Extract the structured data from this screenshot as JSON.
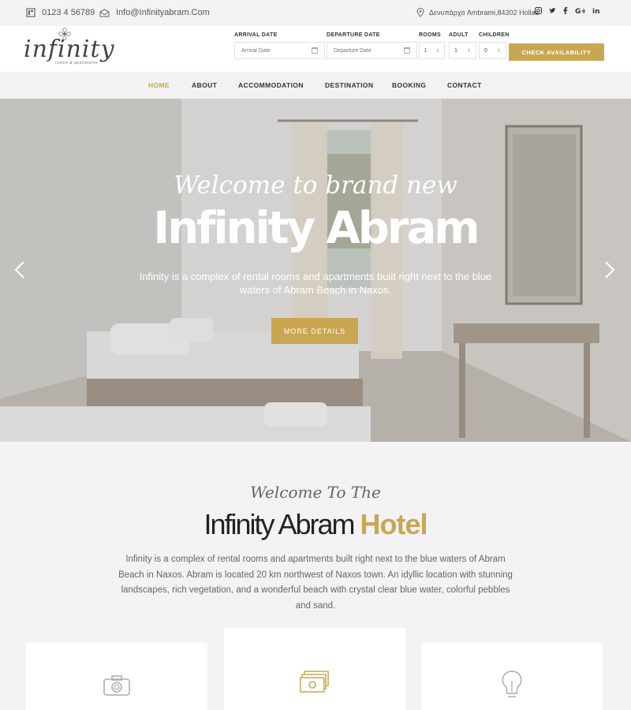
{
  "topbar": {
    "phone": "0123 4 56789",
    "email": "Info@Infinityabram.Com",
    "address": "Δενυπάρχα Ambrami,84302 Hollas",
    "social": [
      "instagram-icon",
      "twitter-icon",
      "facebook-icon",
      "google-plus-icon",
      "linkedin-icon"
    ]
  },
  "logo": {
    "text": "infinity",
    "tagline": "rooms & apartments"
  },
  "booking": {
    "arrival_label": "ARRIVAL DATE",
    "arrival_placeholder": "Arrival Date",
    "departure_label": "DEPARTURE DATE",
    "departure_placeholder": "Departure Date",
    "rooms_label": "ROOMS",
    "rooms_value": "1",
    "adult_label": "ADULT",
    "adult_value": "1",
    "children_label": "CHILDREN",
    "children_value": "0",
    "button": "CHECK AVAILABILITY"
  },
  "nav": {
    "home": "HOME",
    "about": "ABOUT",
    "accommodation": "ACCOMMODATION",
    "destination": "DESTINATION",
    "booking": "BOOKING",
    "contact": "CONTACT"
  },
  "hero": {
    "script": "Welcome to brand new",
    "title": "Infinity Abram",
    "description": "Infinity is a complex of rental rooms and apartments built right next to the blue waters of Abram Beach in Naxos.",
    "button": "MORE DETAILS"
  },
  "welcome": {
    "script": "Welcome To The",
    "title_main": "Infinity Abram",
    "title_accent": "Hotel",
    "text": "Infinity is a complex of rental rooms and apartments built right next to the blue waters of Abram Beach in Naxos. Abram is located 20 km northwest of Naxos town. An idyllic location with stunning landscapes, rich vegetation, and a wonderful beach with crystal clear blue water, colorful pebbles and sand."
  },
  "colors": {
    "accent": "#c9a752",
    "nav_bg": "#f2f2f2",
    "topbar_bg": "#f3f3f3"
  }
}
